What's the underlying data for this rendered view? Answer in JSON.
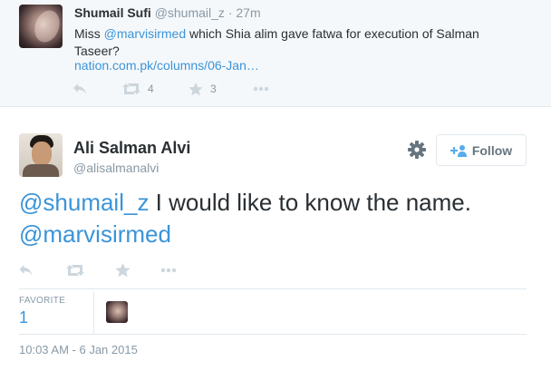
{
  "parent_tweet": {
    "author_name": "Shumail Sufi",
    "author_handle": "@shumail_z",
    "separator": "·",
    "time": "27m",
    "text_prefix": "Miss ",
    "mention": "@marvisirmed",
    "text_suffix": " which Shia alim gave fatwa for execution of Salman Taseer?",
    "link": "nation.com.pk/columns/06-Jan…",
    "retweet_count": "4",
    "favorite_count": "3"
  },
  "main_tweet": {
    "author_name": "Ali Salman Alvi",
    "author_handle": "@alisalmanalvi",
    "follow_label": "Follow",
    "mention_1": "@shumail_z",
    "text": " I would like to know the name. ",
    "mention_2": "@marvisirmed",
    "favorites_label": "FAVORITE",
    "favorites_count": "1",
    "timestamp": "10:03 AM - 6 Jan 2015"
  },
  "colors": {
    "link": "#3b94d9",
    "muted": "#8899a6",
    "icon": "#ccd6dd",
    "parent_background": "#f5f8fa"
  },
  "icons": [
    "reply-icon",
    "retweet-icon",
    "favorite-icon",
    "more-icon",
    "gear-icon",
    "add-user-icon"
  ]
}
